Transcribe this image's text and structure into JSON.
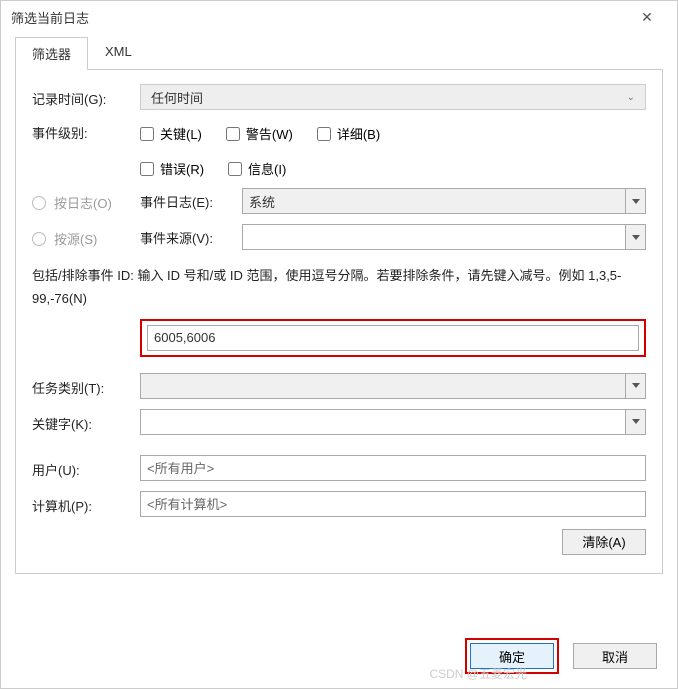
{
  "window": {
    "title": "筛选当前日志"
  },
  "tabs": {
    "filter": "筛选器",
    "xml": "XML"
  },
  "labels": {
    "logged": "记录时间(G):",
    "level": "事件级别:",
    "byLog": "按日志(O)",
    "bySource": "按源(S)",
    "eventLogs": "事件日志(E):",
    "eventSources": "事件来源(V):",
    "hint": "包括/排除事件 ID: 输入 ID 号和/或 ID 范围，使用逗号分隔。若要排除条件，请先键入减号。例如 1,3,5-99,-76(N)",
    "taskCategory": "任务类别(T):",
    "keywords": "关键字(K):",
    "user": "用户(U):",
    "computer": "计算机(P):"
  },
  "loggedOptions": {
    "selected": "任何时间"
  },
  "levels": {
    "critical": "关键(L)",
    "warning": "警告(W)",
    "verbose": "详细(B)",
    "error": "错误(R)",
    "information": "信息(I)"
  },
  "eventLogsValue": "系统",
  "eventIdValue": "6005,6006",
  "userValue": "<所有用户>",
  "computerValue": "<所有计算机>",
  "buttons": {
    "clear": "清除(A)",
    "ok": "确定",
    "cancel": "取消"
  },
  "watermark": "CSDN @五菱宏光"
}
